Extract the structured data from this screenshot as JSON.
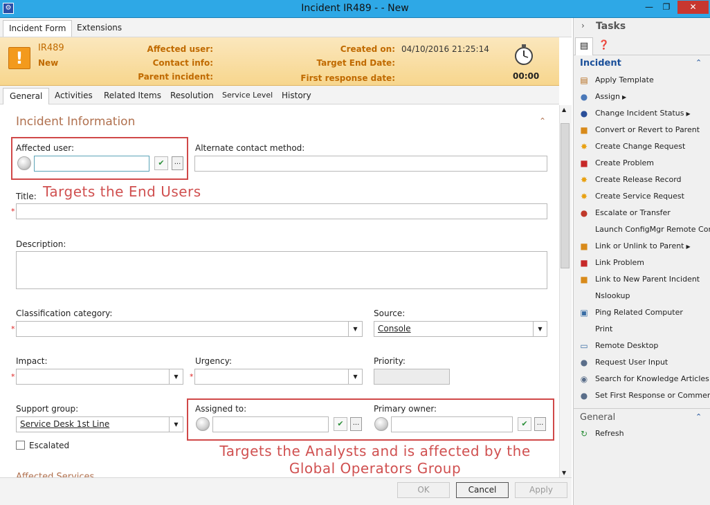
{
  "window": {
    "title": "Incident IR489 -  - New",
    "controls": {
      "minimize": "—",
      "maximize": "❐",
      "close": "✕"
    }
  },
  "form_tabs": [
    "Incident Form",
    "Extensions"
  ],
  "header": {
    "id": "IR489",
    "status": "New",
    "labels": {
      "affected_user": "Affected user:",
      "contact_info": "Contact info:",
      "parent_incident": "Parent incident:",
      "created_on": "Created on:",
      "target_end_date": "Target End Date:",
      "first_response_date": "First response date:"
    },
    "values": {
      "created_on": "04/10/2016 21:25:14"
    },
    "timer": "00:00"
  },
  "sub_tabs": [
    "General",
    "Activities",
    "Related Items",
    "Resolution",
    "Service Level",
    "History"
  ],
  "section": {
    "title": "Incident Information",
    "collapse": "⌃"
  },
  "fields": {
    "affected_user": "Affected user:",
    "alternate_contact": "Alternate contact method:",
    "title": "Title:",
    "description": "Description:",
    "classification": "Classification category:",
    "source": "Source:",
    "source_value": "Console",
    "impact": "Impact:",
    "urgency": "Urgency:",
    "priority": "Priority:",
    "support_group": "Support group:",
    "support_group_value": "Service Desk 1st Line",
    "assigned_to": "Assigned to:",
    "primary_owner": "Primary owner:",
    "escalated": "Escalated",
    "affected_services": "Affected Services",
    "required_marker": "*",
    "dots": "..."
  },
  "annotations": {
    "end_users": "Targets the End Users",
    "analysts_line1": "Targets the Analysts and is affected by the",
    "analysts_line2": "Global Operators Group"
  },
  "footer": {
    "ok": "OK",
    "cancel": "Cancel",
    "apply": "Apply"
  },
  "task_pane": {
    "title": "Tasks",
    "incident_group": "Incident",
    "general_group": "General",
    "tasks": [
      {
        "label": "Apply Template",
        "icon": "template-icon",
        "glyph": "▤",
        "color": "#b56a1a"
      },
      {
        "label": "Assign",
        "icon": "user-icon",
        "glyph": "●",
        "color": "#4a78b8",
        "submenu": true
      },
      {
        "label": "Change Incident Status",
        "icon": "info-icon",
        "glyph": "●",
        "color": "#2a4f9a",
        "submenu": true
      },
      {
        "label": "Convert or Revert to Parent",
        "icon": "convert-icon",
        "glyph": "■",
        "color": "#d88a1a"
      },
      {
        "label": "Create Change Request",
        "icon": "star-icon",
        "glyph": "✸",
        "color": "#e8a010"
      },
      {
        "label": "Create Problem",
        "icon": "problem-icon",
        "glyph": "■",
        "color": "#c62828"
      },
      {
        "label": "Create Release Record",
        "icon": "star-icon",
        "glyph": "✸",
        "color": "#e8a010"
      },
      {
        "label": "Create Service Request",
        "icon": "star-icon",
        "glyph": "✸",
        "color": "#e8a010"
      },
      {
        "label": "Escalate or Transfer",
        "icon": "escalate-icon",
        "glyph": "●",
        "color": "#c0392b"
      },
      {
        "label": "Launch ConfigMgr Remote Control",
        "icon": "blank-icon",
        "glyph": "",
        "color": "#888"
      },
      {
        "label": "Link or Unlink to Parent",
        "icon": "link-icon",
        "glyph": "■",
        "color": "#d88a1a",
        "submenu": true
      },
      {
        "label": "Link Problem",
        "icon": "problem-icon",
        "glyph": "■",
        "color": "#c62828"
      },
      {
        "label": "Link to New Parent Incident",
        "icon": "link-icon",
        "glyph": "■",
        "color": "#d88a1a"
      },
      {
        "label": "Nslookup",
        "icon": "blank-icon",
        "glyph": "",
        "color": "#888"
      },
      {
        "label": "Ping Related Computer",
        "icon": "computer-icon",
        "glyph": "▣",
        "color": "#3a6ea5"
      },
      {
        "label": "Print",
        "icon": "blank-icon",
        "glyph": "",
        "color": "#888"
      },
      {
        "label": "Remote Desktop",
        "icon": "monitor-icon",
        "glyph": "▭",
        "color": "#3a6ea5"
      },
      {
        "label": "Request User Input",
        "icon": "user-input-icon",
        "glyph": "●",
        "color": "#5a6e8a"
      },
      {
        "label": "Search for Knowledge Articles",
        "icon": "search-icon",
        "glyph": "◉",
        "color": "#5a6e8a"
      },
      {
        "label": "Set First Response or Comment",
        "icon": "comment-icon",
        "glyph": "●",
        "color": "#5a6e8a"
      }
    ],
    "general_tasks": [
      {
        "label": "Refresh",
        "icon": "refresh-icon",
        "glyph": "↻",
        "color": "#2c8f3a"
      }
    ]
  }
}
